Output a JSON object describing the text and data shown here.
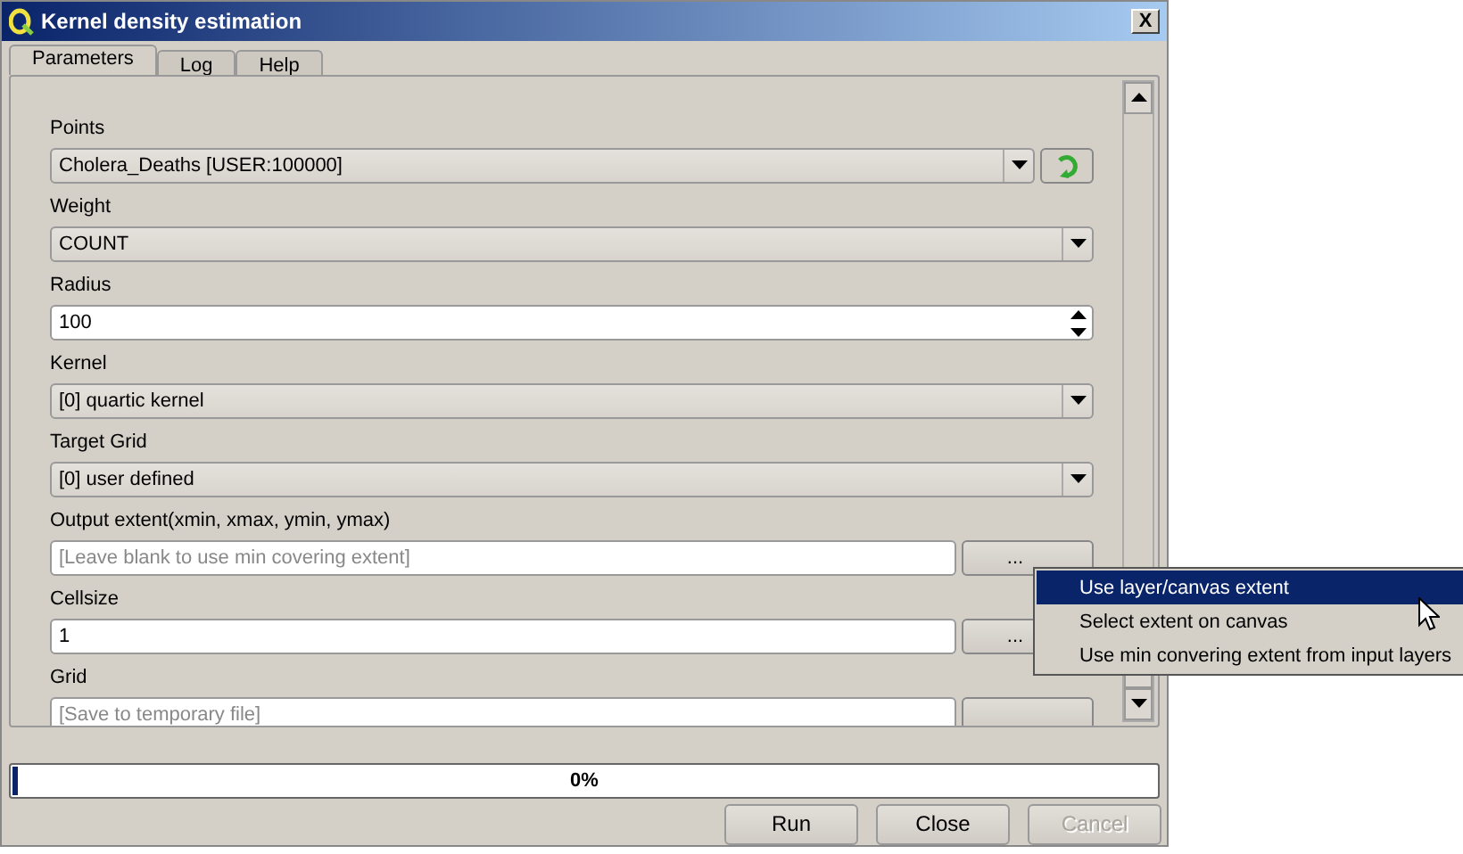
{
  "window": {
    "title": "Kernel density estimation",
    "close": "X"
  },
  "tabs": [
    {
      "label": "Parameters",
      "selected": true
    },
    {
      "label": "Log",
      "selected": false
    },
    {
      "label": "Help",
      "selected": false
    }
  ],
  "parameters": [
    {
      "kind": "layer",
      "label": "Points",
      "value": "Cholera_Deaths [USER:100000]"
    },
    {
      "kind": "combo",
      "label": "Weight",
      "value": "COUNT"
    },
    {
      "kind": "spin",
      "label": "Radius",
      "value": "100"
    },
    {
      "kind": "combo",
      "label": "Kernel",
      "value": "[0] quartic kernel"
    },
    {
      "kind": "combo",
      "label": "Target Grid",
      "value": "[0] user defined"
    },
    {
      "kind": "browse",
      "label": "Output extent(xmin, xmax, ymin, ymax)",
      "placeholder": "[Leave blank to use min covering extent]",
      "button": "..."
    },
    {
      "kind": "browse",
      "label": "Cellsize",
      "value": "1",
      "button": "..."
    },
    {
      "kind": "browse",
      "label": "Grid",
      "placeholder": "[Save to temporary file]"
    }
  ],
  "progress": {
    "level": 0.004,
    "reading": "0%"
  },
  "buttons": [
    {
      "label": "Run",
      "disabled": false
    },
    {
      "label": "Close",
      "disabled": false
    },
    {
      "label": "Cancel",
      "disabled": true
    }
  ],
  "context_menu": [
    {
      "label": "Use layer/canvas extent",
      "selected": true
    },
    {
      "label": "Select extent on canvas",
      "selected": false
    },
    {
      "label": "Use min convering extent from input layers",
      "selected": false
    }
  ]
}
